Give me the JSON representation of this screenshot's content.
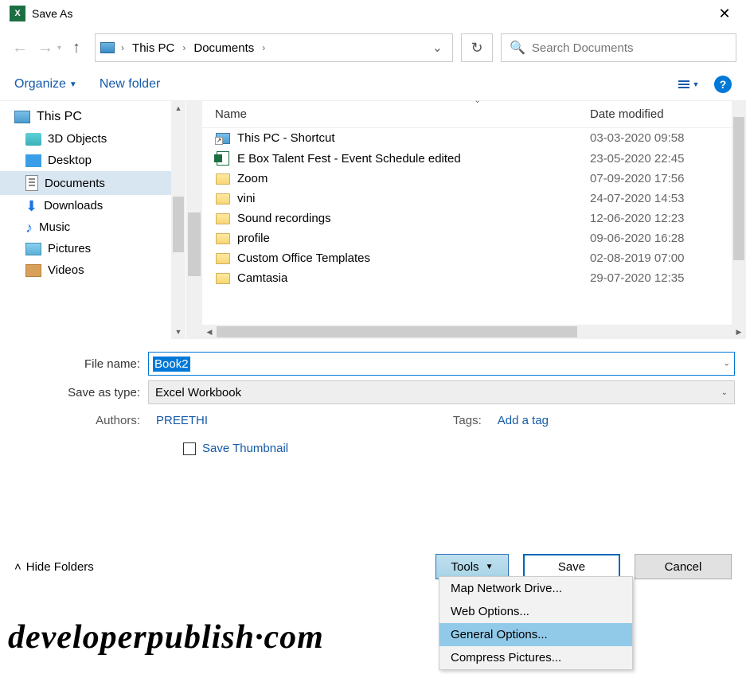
{
  "window": {
    "title": "Save As"
  },
  "breadcrumb": {
    "root": "This PC",
    "folder": "Documents"
  },
  "search": {
    "placeholder": "Search Documents"
  },
  "toolbar": {
    "organize": "Organize",
    "newfolder": "New folder"
  },
  "sidebar": {
    "items": [
      {
        "label": "This PC",
        "icon": "pc",
        "top": true
      },
      {
        "label": "3D Objects",
        "icon": "3d"
      },
      {
        "label": "Desktop",
        "icon": "desk"
      },
      {
        "label": "Documents",
        "icon": "doc",
        "selected": true
      },
      {
        "label": "Downloads",
        "icon": "dl"
      },
      {
        "label": "Music",
        "icon": "music"
      },
      {
        "label": "Pictures",
        "icon": "pic"
      },
      {
        "label": "Videos",
        "icon": "vid"
      }
    ]
  },
  "list": {
    "col_name": "Name",
    "col_date": "Date modified",
    "rows": [
      {
        "icon": "shortcut",
        "name": "This PC - Shortcut",
        "date": "03-03-2020 09:58"
      },
      {
        "icon": "excel",
        "name": "E Box Talent Fest - Event Schedule edited",
        "date": "23-05-2020 22:45"
      },
      {
        "icon": "folder",
        "name": "Zoom",
        "date": "07-09-2020 17:56"
      },
      {
        "icon": "folder",
        "name": "vini",
        "date": "24-07-2020 14:53"
      },
      {
        "icon": "folder",
        "name": "Sound recordings",
        "date": "12-06-2020 12:23"
      },
      {
        "icon": "folder",
        "name": "profile",
        "date": "09-06-2020 16:28"
      },
      {
        "icon": "folder",
        "name": "Custom Office Templates",
        "date": "02-08-2019 07:00"
      },
      {
        "icon": "folder",
        "name": "Camtasia",
        "date": "29-07-2020 12:35"
      }
    ]
  },
  "form": {
    "filename_label": "File name:",
    "filename_value": "Book2",
    "type_label": "Save as type:",
    "type_value": "Excel Workbook",
    "authors_label": "Authors:",
    "authors_value": "PREETHI",
    "tags_label": "Tags:",
    "tags_value": "Add a tag",
    "thumb_label": "Save Thumbnail"
  },
  "footer": {
    "hide": "Hide Folders",
    "tools": "Tools",
    "save": "Save",
    "cancel": "Cancel"
  },
  "tools_menu": {
    "items": [
      "Map Network Drive...",
      "Web Options...",
      "General Options...",
      "Compress Pictures..."
    ],
    "hover_index": 2
  },
  "watermark": "developerpublish·com"
}
